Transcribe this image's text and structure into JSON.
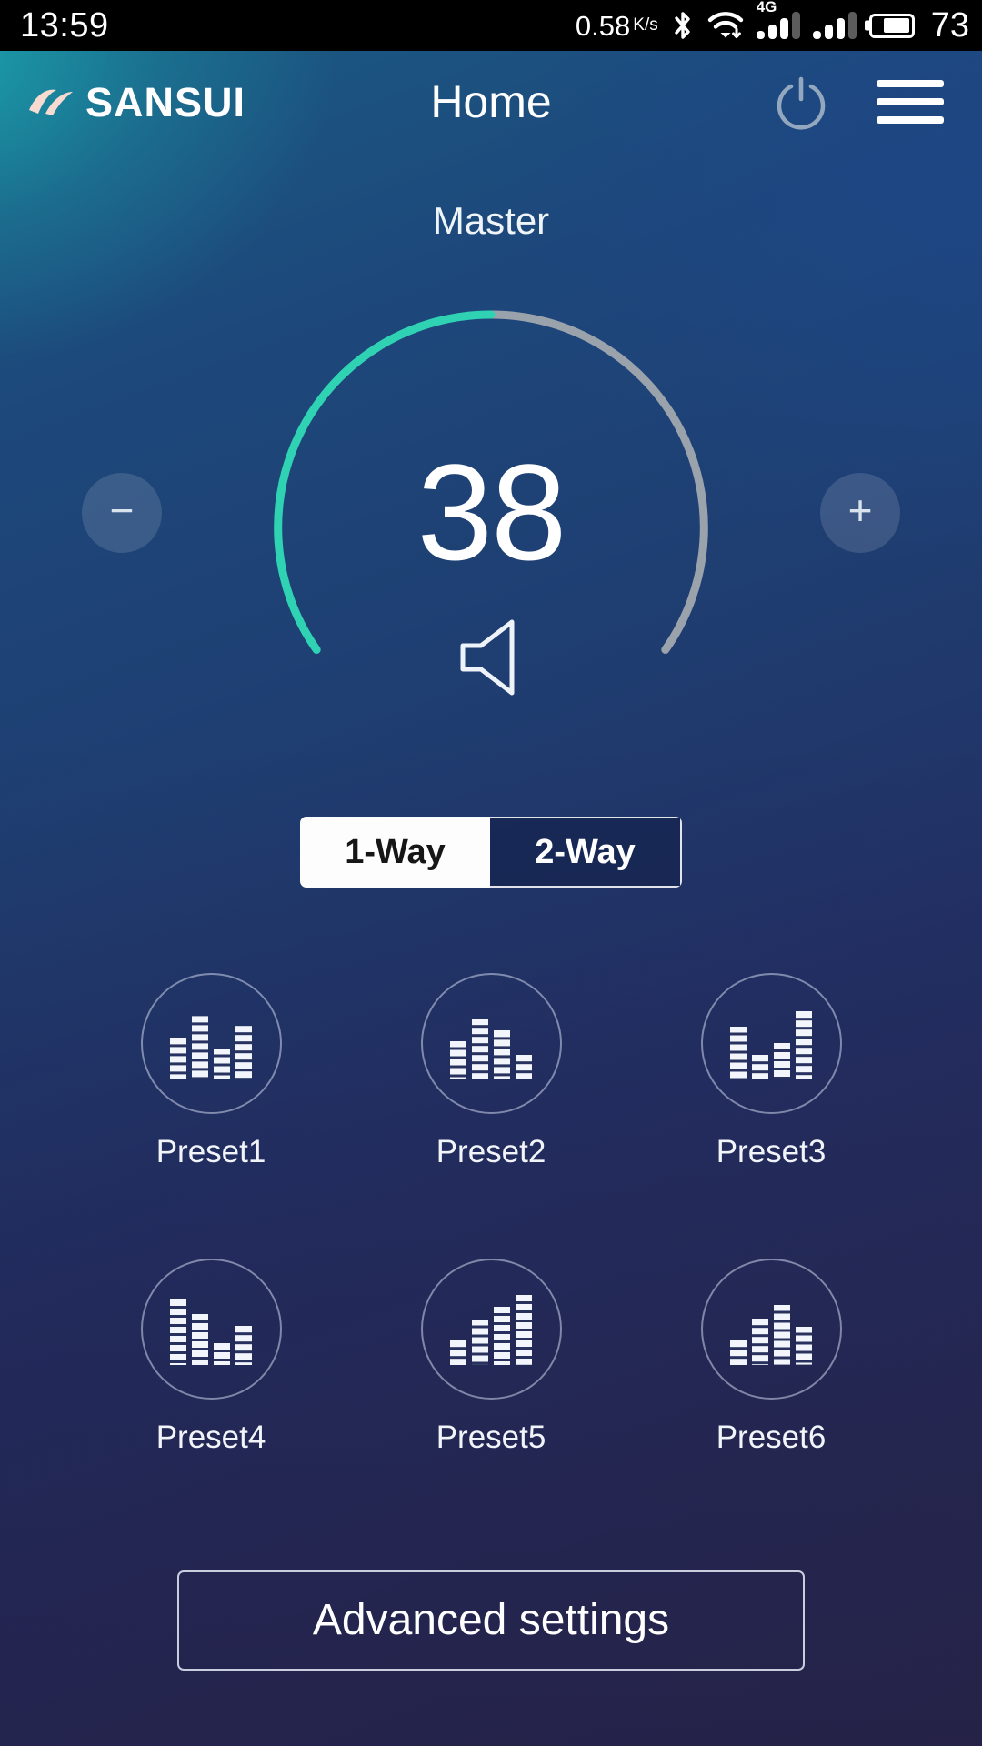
{
  "statusbar": {
    "time": "13:59",
    "network_speed": "0.58",
    "network_unit": "K/s",
    "bluetooth_icon": "bluetooth-icon",
    "wifi_icon": "wifi-download-icon",
    "mobile_label": "4G",
    "battery_percent": "73"
  },
  "header": {
    "brand": "SANSUI",
    "title": "Home",
    "power_icon": "power-icon",
    "menu_icon": "hamburger-menu-icon"
  },
  "volume": {
    "zone_label": "Master",
    "value": "38",
    "minus_label": "−",
    "plus_label": "+",
    "speaker_icon": "speaker-icon",
    "arc_active_color": "#2fd3b4",
    "arc_track_color": "#9aa2ac",
    "arc_start_deg": 215,
    "arc_end_deg": 145,
    "arc_value_deg": 372
  },
  "way_toggle": {
    "options": [
      {
        "label": "1-Way",
        "selected": true
      },
      {
        "label": "2-Way",
        "selected": false
      }
    ]
  },
  "presets": [
    {
      "label": "Preset1",
      "bars": [
        0.58,
        0.88,
        0.42,
        0.74
      ]
    },
    {
      "label": "Preset2",
      "bars": [
        0.52,
        0.84,
        0.68,
        0.34
      ]
    },
    {
      "label": "Preset3",
      "bars": [
        0.72,
        0.34,
        0.5,
        0.94
      ]
    },
    {
      "label": "Preset4",
      "bars": [
        0.9,
        0.7,
        0.3,
        0.54
      ]
    },
    {
      "label": "Preset5",
      "bars": [
        0.34,
        0.62,
        0.8,
        0.96
      ]
    },
    {
      "label": "Preset6",
      "bars": [
        0.34,
        0.64,
        0.82,
        0.52
      ]
    }
  ],
  "advanced_settings": {
    "label": "Advanced settings"
  },
  "colors": {
    "accent_teal": "#2fd3b4",
    "brand_mark": "#f6d6cc",
    "bg_top_left": "#1ba5af",
    "bg_bottom": "#2b2749"
  }
}
